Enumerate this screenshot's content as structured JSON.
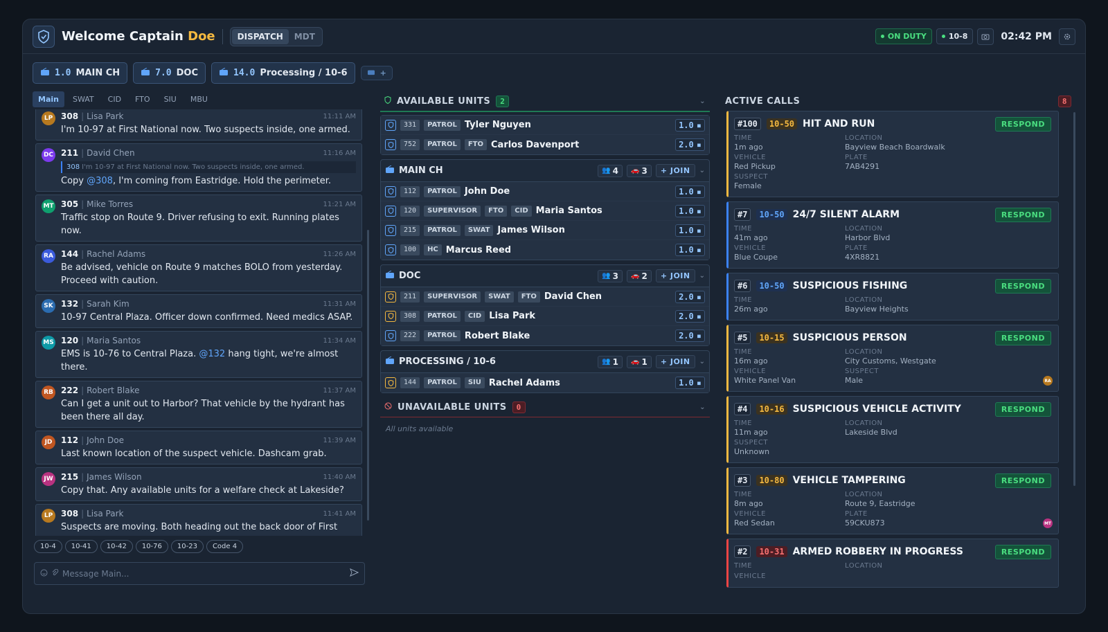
{
  "header": {
    "welcome_prefix": "Welcome Captain",
    "welcome_name": "Doe",
    "modes": [
      "DISPATCH",
      "MDT"
    ],
    "active_mode": "DISPATCH",
    "duty_status": "ON DUTY",
    "ten_code": "10-8",
    "clock": "02:42 PM"
  },
  "channels": [
    {
      "freq": "1.0",
      "name": "MAIN CH"
    },
    {
      "freq": "7.0",
      "name": "DOC"
    },
    {
      "freq": "14.0",
      "name": "Processing / 10-6"
    }
  ],
  "add_channel_label": "+",
  "chat": {
    "tabs": [
      "Main",
      "SWAT",
      "CID",
      "FTO",
      "SIU",
      "MBU"
    ],
    "active_tab": "Main",
    "messages": [
      {
        "initials": "LP",
        "color": "#b7791f",
        "callsign": "308",
        "name": "Lisa Park",
        "time": "11:11 AM",
        "text": "I'm 10-97 at First National now. Two suspects inside, one armed."
      },
      {
        "initials": "DC",
        "color": "#7c3aed",
        "callsign": "211",
        "name": "David Chen",
        "time": "11:16 AM",
        "quote_call": "308",
        "quote_text": "I'm 10-97 at First National now. Two suspects inside, one armed.",
        "pre": "Copy ",
        "mention": "@308",
        "post": ", I'm coming from Eastridge. Hold the perimeter."
      },
      {
        "initials": "MT",
        "color": "#0f9f6e",
        "callsign": "305",
        "name": "Mike Torres",
        "time": "11:21 AM",
        "text": "Traffic stop on Route 9. Driver refusing to exit. Running plates now."
      },
      {
        "initials": "RA",
        "color": "#3b5bdb",
        "callsign": "144",
        "name": "Rachel Adams",
        "time": "11:26 AM",
        "text": "Be advised, vehicle on Route 9 matches BOLO from yesterday. Proceed with caution."
      },
      {
        "initials": "SK",
        "color": "#2b6cb0",
        "callsign": "132",
        "name": "Sarah Kim",
        "time": "11:31 AM",
        "text": "10-97 Central Plaza. Officer down confirmed. Need medics ASAP."
      },
      {
        "initials": "MS",
        "color": "#0e9aa7",
        "callsign": "120",
        "name": "Maria Santos",
        "time": "11:34 AM",
        "pre": "EMS is 10-76 to Central Plaza. ",
        "mention": "@132",
        "post": " hang tight, we're almost there."
      },
      {
        "initials": "RB",
        "color": "#c05621",
        "callsign": "222",
        "name": "Robert Blake",
        "time": "11:37 AM",
        "text": "Can I get a unit out to Harbor? That vehicle by the hydrant has been there all day."
      },
      {
        "initials": "JD",
        "color": "#c05621",
        "callsign": "112",
        "name": "John Doe",
        "time": "11:39 AM",
        "text": "Last known location of the suspect vehicle. Dashcam grab."
      },
      {
        "initials": "JW",
        "color": "#b83280",
        "callsign": "215",
        "name": "James Wilson",
        "time": "11:40 AM",
        "text": "Copy that. Any available units for a welfare check at Lakeside?"
      },
      {
        "initials": "LP",
        "color": "#b7791f",
        "callsign": "308",
        "name": "Lisa Park",
        "time": "11:41 AM",
        "text": "Suspects are moving. Both heading out the back door of First National. Need backup NOW."
      }
    ],
    "quick_codes": [
      "10-4",
      "10-41",
      "10-42",
      "10-76",
      "10-23",
      "Code 4"
    ],
    "input_placeholder": "Message Main..."
  },
  "available": {
    "title": "AVAILABLE UNITS",
    "count": "2",
    "units": [
      {
        "callsign": "331",
        "tags": [
          "PATROL"
        ],
        "name": "Tyler Nguyen",
        "freq": "1.0"
      },
      {
        "callsign": "752",
        "tags": [
          "PATROL",
          "FTO"
        ],
        "name": "Carlos Davenport",
        "freq": "2.0"
      }
    ]
  },
  "groups": [
    {
      "name": "MAIN CH",
      "members": "4",
      "vehicles": "3",
      "join": "+ JOIN",
      "units": [
        {
          "callsign": "112",
          "tags": [
            "PATROL"
          ],
          "name": "John Doe",
          "freq": "1.0"
        },
        {
          "callsign": "120",
          "tags": [
            "SUPERVISOR",
            "FTO",
            "CID"
          ],
          "name": "Maria Santos",
          "freq": "1.0"
        },
        {
          "callsign": "215",
          "tags": [
            "PATROL",
            "SWAT"
          ],
          "name": "James Wilson",
          "freq": "1.0"
        },
        {
          "callsign": "100",
          "tags": [
            "HC"
          ],
          "name": "Marcus Reed",
          "freq": "1.0"
        }
      ]
    },
    {
      "name": "DOC",
      "members": "3",
      "vehicles": "2",
      "join": "+ JOIN",
      "units": [
        {
          "callsign": "211",
          "tags": [
            "SUPERVISOR",
            "SWAT",
            "FTO"
          ],
          "name": "David Chen",
          "freq": "2.0"
        },
        {
          "callsign": "308",
          "tags": [
            "PATROL",
            "CID"
          ],
          "name": "Lisa Park",
          "freq": "2.0"
        },
        {
          "callsign": "222",
          "tags": [
            "PATROL"
          ],
          "name": "Robert Blake",
          "freq": "2.0"
        }
      ]
    },
    {
      "name": "PROCESSING / 10-6",
      "members": "1",
      "vehicles": "1",
      "join": "+ JOIN",
      "units": [
        {
          "callsign": "144",
          "tags": [
            "PATROL",
            "SIU"
          ],
          "name": "Rachel Adams",
          "freq": "1.0"
        }
      ]
    }
  ],
  "unavailable": {
    "title": "UNAVAILABLE UNITS",
    "count": "0",
    "empty": "All units available"
  },
  "calls": {
    "title": "ACTIVE CALLS",
    "count": "8",
    "respond_label": "RESPOND",
    "items": [
      {
        "id": "#100",
        "code": "10-50",
        "color": "yellow",
        "title": "HIT AND RUN",
        "fields": [
          [
            "TIME",
            "1m ago"
          ],
          [
            "LOCATION",
            "Bayview Beach Boardwalk"
          ],
          [
            "VEHICLE",
            "Red Pickup"
          ],
          [
            "PLATE",
            "7AB4291"
          ],
          [
            "SUSPECT",
            "Female"
          ]
        ]
      },
      {
        "id": "#7",
        "code": "10-50",
        "color": "blue",
        "title": "24/7 SILENT ALARM",
        "fields": [
          [
            "TIME",
            "41m ago"
          ],
          [
            "LOCATION",
            "Harbor Blvd"
          ],
          [
            "VEHICLE",
            "Blue Coupe"
          ],
          [
            "PLATE",
            "4XR8821"
          ]
        ]
      },
      {
        "id": "#6",
        "code": "10-50",
        "color": "blue",
        "title": "SUSPICIOUS FISHING",
        "fields": [
          [
            "TIME",
            "26m ago"
          ],
          [
            "LOCATION",
            "Bayview Heights"
          ]
        ]
      },
      {
        "id": "#5",
        "code": "10-15",
        "color": "yellow",
        "title": "SUSPICIOUS PERSON",
        "fields": [
          [
            "TIME",
            "16m ago"
          ],
          [
            "LOCATION",
            "City Customs, Westgate"
          ],
          [
            "VEHICLE",
            "White Panel Van"
          ],
          [
            "SUSPECT",
            "Male"
          ]
        ],
        "badge": "RA"
      },
      {
        "id": "#4",
        "code": "10-16",
        "color": "yellow",
        "title": "SUSPICIOUS VEHICLE ACTIVITY",
        "fields": [
          [
            "TIME",
            "11m ago"
          ],
          [
            "LOCATION",
            "Lakeside Blvd"
          ],
          [
            "SUSPECT",
            "Unknown"
          ]
        ]
      },
      {
        "id": "#3",
        "code": "10-80",
        "color": "yellow",
        "title": "VEHICLE TAMPERING",
        "fields": [
          [
            "TIME",
            "8m ago"
          ],
          [
            "LOCATION",
            "Route 9, Eastridge"
          ],
          [
            "VEHICLE",
            "Red Sedan"
          ],
          [
            "PLATE",
            "59CKU873"
          ]
        ],
        "badge": "MT"
      },
      {
        "id": "#2",
        "code": "10-31",
        "color": "red",
        "title": "ARMED ROBBERY IN PROGRESS",
        "fields": [
          [
            "TIME",
            ""
          ],
          [
            "LOCATION",
            ""
          ],
          [
            "VEHICLE",
            ""
          ]
        ]
      }
    ]
  }
}
